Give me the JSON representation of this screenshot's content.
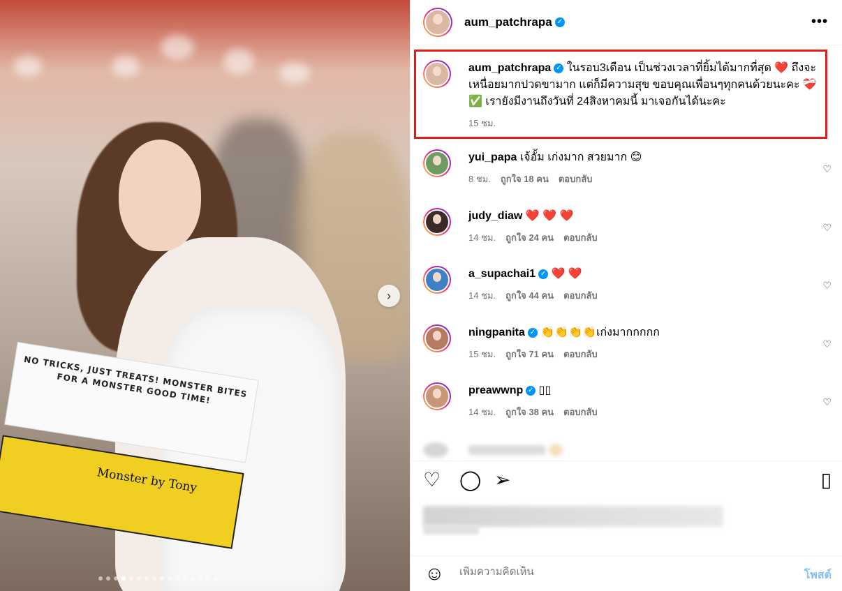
{
  "header": {
    "username": "aum_patchrapa",
    "verified_icon": "✓",
    "more_icon": "•••"
  },
  "caption": {
    "username": "aum_patchrapa",
    "text_part1": " ในรอบ3เดือน เป็นช่วงเวลาที่ยิ้มได้มากที่สุด ",
    "heart1": "❤️",
    "text_part2": " ถึงจะเหนื่อยมากปวดขามาก แต่ก็มีความสุข ขอบคุณเพื่อนๆทุกคนด้วยนะคะ ",
    "heart2": "❤️‍🩹",
    "check": "✅",
    "text_part3": " เรายังมีงานถึงวันที่ 24สิงหาคมนี้ มาเจอกันได้นะคะ",
    "time": "15 ชม."
  },
  "comments": [
    {
      "username": "yui_papa",
      "verified": false,
      "text": " เจ้อั้ม เก่งมาก สวยมาก 😊",
      "time": "8 ชม.",
      "likes": "ถูกใจ 18 คน",
      "reply": "ตอบกลับ"
    },
    {
      "username": "judy_diaw",
      "verified": false,
      "text": " ❤️ ❤️ ❤️",
      "time": "14 ชม.",
      "likes": "ถูกใจ 24 คน",
      "reply": "ตอบกลับ"
    },
    {
      "username": "a_supachai1",
      "verified": true,
      "text": " ❤️ ❤️",
      "time": "14 ชม.",
      "likes": "ถูกใจ 44 คน",
      "reply": "ตอบกลับ"
    },
    {
      "username": "ningpanita",
      "verified": true,
      "text": " 👏👏👏👏เก่งมากกกกก",
      "time": "15 ชม.",
      "likes": "ถูกใจ 71 คน",
      "reply": "ตอบกลับ"
    },
    {
      "username": "preawwnp",
      "verified": true,
      "text": " ▯▯",
      "time": "14 ชม.",
      "likes": "ถูกใจ 38 คน",
      "reply": "ตอบกลับ"
    }
  ],
  "photo": {
    "box_lid_text": "NO TRICKS, JUST TREATS! MONSTER BITES FOR A MONSTER GOOD TIME!",
    "box_front_text": "Monster by Tony",
    "next_icon": "›",
    "carousel_dot_count": 16,
    "active_dot_index": 3
  },
  "actions": {
    "like_icon": "♡",
    "comment_icon": "◯",
    "share_icon": "➢",
    "save_icon": "▯",
    "comment_like_icon": "♡"
  },
  "add_comment": {
    "emoji_icon": "☺",
    "placeholder": "เพิ่มความคิดเห็น",
    "post_label": "โพสต์"
  },
  "colors": {
    "highlight_border": "#e21b1b",
    "verified": "#0095f6",
    "post_button": "#86bff8"
  }
}
